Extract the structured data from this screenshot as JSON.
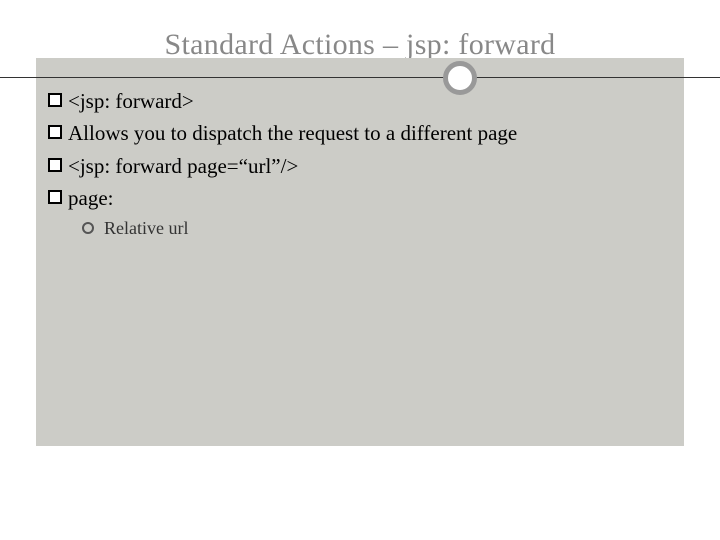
{
  "title": "Standard Actions – jsp: forward",
  "bullets": [
    {
      "text": "<jsp: forward>"
    },
    {
      "text": "Allows you to dispatch the request to a different page"
    },
    {
      "text": "<jsp: forward page=“url”/>"
    },
    {
      "text": "page:"
    }
  ],
  "sub": {
    "text": "Relative url"
  }
}
